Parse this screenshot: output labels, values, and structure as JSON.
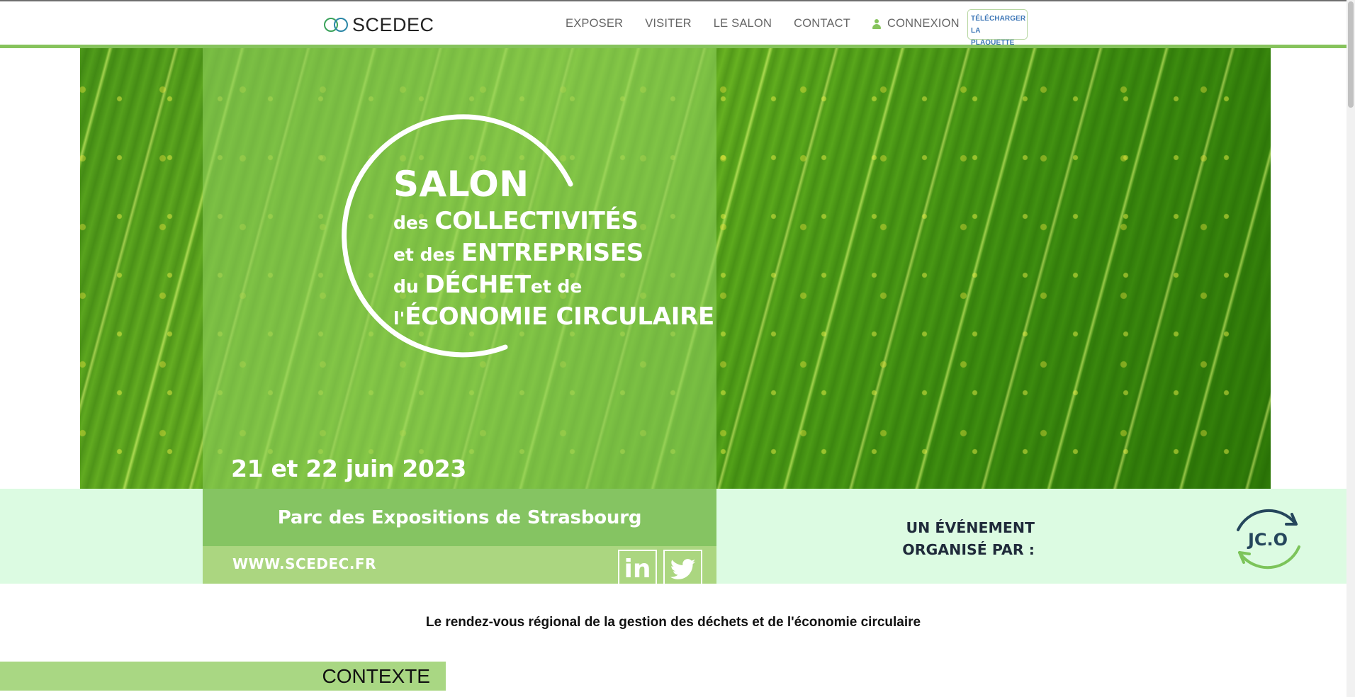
{
  "nav": {
    "logo_text": "SCEDEC",
    "menu": [
      "EXPOSER",
      "VISITER",
      "LE SALON",
      "CONTACT"
    ],
    "login": "CONNEXION",
    "download": [
      "TÉLÉCHARGER",
      "LA PLAQUETTE"
    ]
  },
  "hero": {
    "title": "SALON",
    "line1_small": "des ",
    "line1_big": "COLLECTIVITÉS",
    "line2_small": "et des ",
    "line2_big": "ENTREPRISES",
    "line3_small": "du ",
    "line3_big": "DÉCHET",
    "line3_tail": "et de",
    "line4_small": "l'",
    "line4_big": "ÉCONOMIE CIRCULAIRE",
    "date": "21 et 22 juin 2023"
  },
  "banner": {
    "venue": "Parc des Expositions de Strasbourg",
    "website": "WWW.SCEDEC.FR",
    "linkedin": "in",
    "organized_line1": "UN ÉVÉNEMENT",
    "organized_line2": "ORGANISÉ PAR :",
    "organizer_logo": "JC.O"
  },
  "tagline": "Le rendez-vous régional de la gestion des déchets et de l'économie circulaire",
  "section_title": "CONTEXTE",
  "colors": {
    "accent_green": "#86c35c",
    "banner_bg": "#dcfbe2",
    "link_blue": "#3e77b7"
  }
}
